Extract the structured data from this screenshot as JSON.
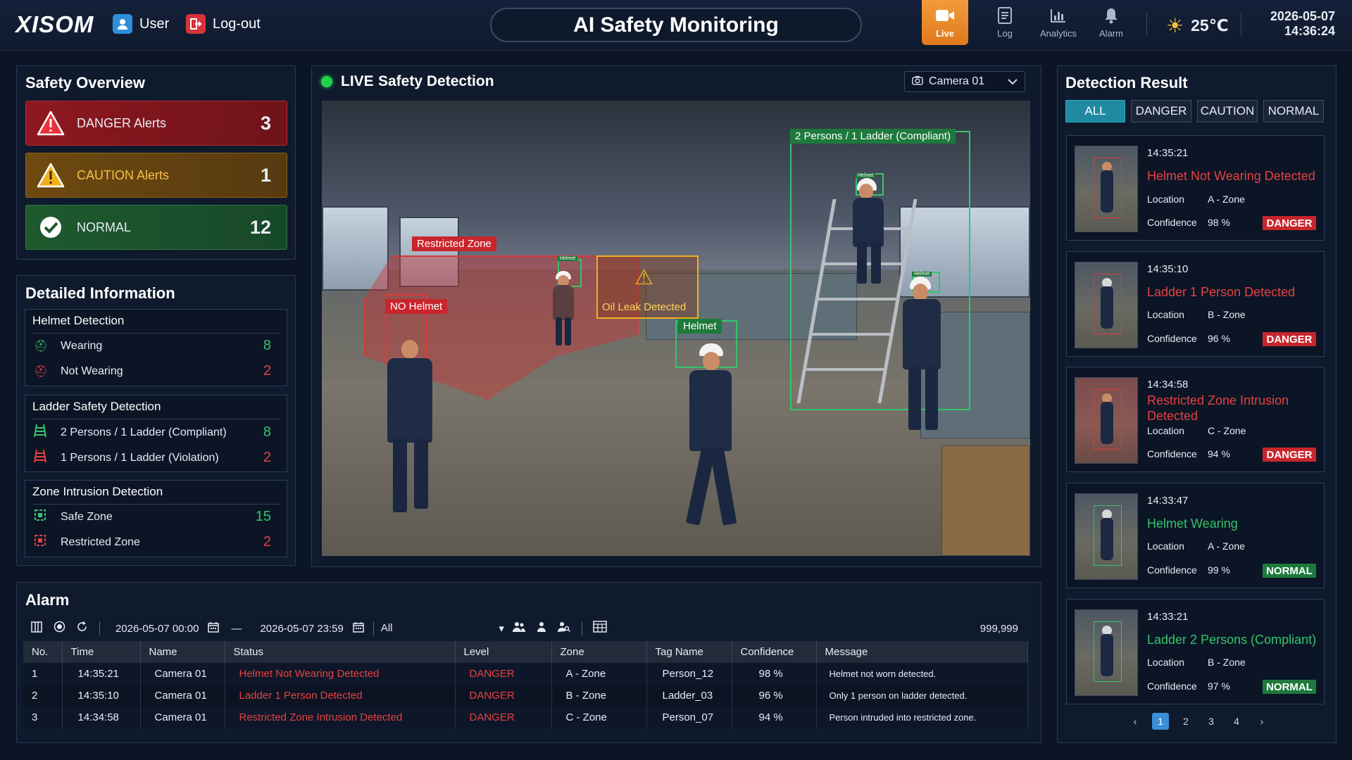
{
  "header": {
    "logo": "XISOM",
    "user_label": "User",
    "logout_label": "Log-out",
    "title": "AI Safety Monitoring",
    "nav": [
      {
        "label": "Live",
        "icon": "video-camera-icon",
        "active": true
      },
      {
        "label": "Log",
        "icon": "document-icon",
        "active": false
      },
      {
        "label": "Analytics",
        "icon": "bar-chart-icon",
        "active": false
      },
      {
        "label": "Alarm",
        "icon": "bell-icon",
        "active": false
      }
    ],
    "temperature": "25℃",
    "date": "2026-05-07",
    "time": "14:36:24"
  },
  "overview": {
    "title": "Safety Overview",
    "danger": {
      "label": "DANGER Alerts",
      "count": "3",
      "color": "#c8262c"
    },
    "caution": {
      "label": "CAUTION Alerts",
      "count": "1",
      "color": "#f0b01e"
    },
    "normal": {
      "label": "NORMAL",
      "count": "12",
      "color": "#35c46a"
    }
  },
  "details": {
    "title": "Detailed Information",
    "helmet": {
      "title": "Helmet Detection",
      "rows": [
        {
          "label": "Wearing",
          "value": "8"
        },
        {
          "label": "Not Wearing",
          "value": "2"
        }
      ]
    },
    "ladder": {
      "title": "Ladder Safety Detection",
      "rows": [
        {
          "label": "2 Persons / 1 Ladder (Compliant)",
          "value": "8"
        },
        {
          "label": "1 Persons / 1 Ladder (Violation)",
          "value": "2"
        }
      ]
    },
    "zone": {
      "title": "Zone Intrusion Detection",
      "rows": [
        {
          "label": "Safe Zone",
          "value": "15"
        },
        {
          "label": "Restricted Zone",
          "value": "2"
        }
      ]
    }
  },
  "live": {
    "badge": "LIVE",
    "title": "Safety Detection",
    "camera": "Camera 01",
    "tags": {
      "compliant": "2 Persons / 1 Ladder (Compliant)",
      "restricted": "Restricted Zone",
      "no_helmet": "NO Helmet",
      "oil": "Oil Leak Detected",
      "helmet": "Helmet",
      "mini_helmet": "Helmet"
    }
  },
  "detection": {
    "title": "Detection Result",
    "filters": [
      "ALL",
      "DANGER",
      "CAUTION",
      "NORMAL"
    ],
    "location_label": "Location",
    "confidence_label": "Confidence",
    "items": [
      {
        "time": "14:35:21",
        "title": "Helmet Not Wearing Detected",
        "location": "A - Zone",
        "confidence": "98 %",
        "level": "DANGER"
      },
      {
        "time": "14:35:10",
        "title": "Ladder 1 Person Detected",
        "location": "B - Zone",
        "confidence": "96 %",
        "level": "DANGER"
      },
      {
        "time": "14:34:58",
        "title": "Restricted Zone Intrusion Detected",
        "location": "C - Zone",
        "confidence": "94 %",
        "level": "DANGER"
      },
      {
        "time": "14:33:47",
        "title": "Helmet Wearing",
        "location": "A - Zone",
        "confidence": "99 %",
        "level": "NORMAL"
      },
      {
        "time": "14:33:21",
        "title": "Ladder 2 Persons (Compliant)",
        "location": "B - Zone",
        "confidence": "97 %",
        "level": "NORMAL"
      }
    ],
    "pages": [
      "1",
      "2",
      "3",
      "4"
    ],
    "current_page": "1"
  },
  "alarm": {
    "title": "Alarm",
    "start": "2026-05-07 00:00",
    "end": "2026-05-07 23:59",
    "range_sep": "—",
    "filter": "All",
    "count": "999,999",
    "columns": [
      "No.",
      "Time",
      "Name",
      "Status",
      "Level",
      "Zone",
      "Tag Name",
      "Confidence",
      "Message"
    ],
    "rows": [
      [
        "1",
        "14:35:21",
        "Camera 01",
        "Helmet Not Wearing Detected",
        "DANGER",
        "A - Zone",
        "Person_12",
        "98 %",
        "Helmet not worn detected."
      ],
      [
        "2",
        "14:35:10",
        "Camera 01",
        "Ladder 1 Person Detected",
        "DANGER",
        "B - Zone",
        "Ladder_03",
        "96 %",
        "Only 1 person on ladder detected."
      ],
      [
        "3",
        "14:34:58",
        "Camera 01",
        "Restricted Zone Intrusion Detected",
        "DANGER",
        "C - Zone",
        "Person_07",
        "94 %",
        "Person intruded into restricted zone."
      ]
    ]
  }
}
